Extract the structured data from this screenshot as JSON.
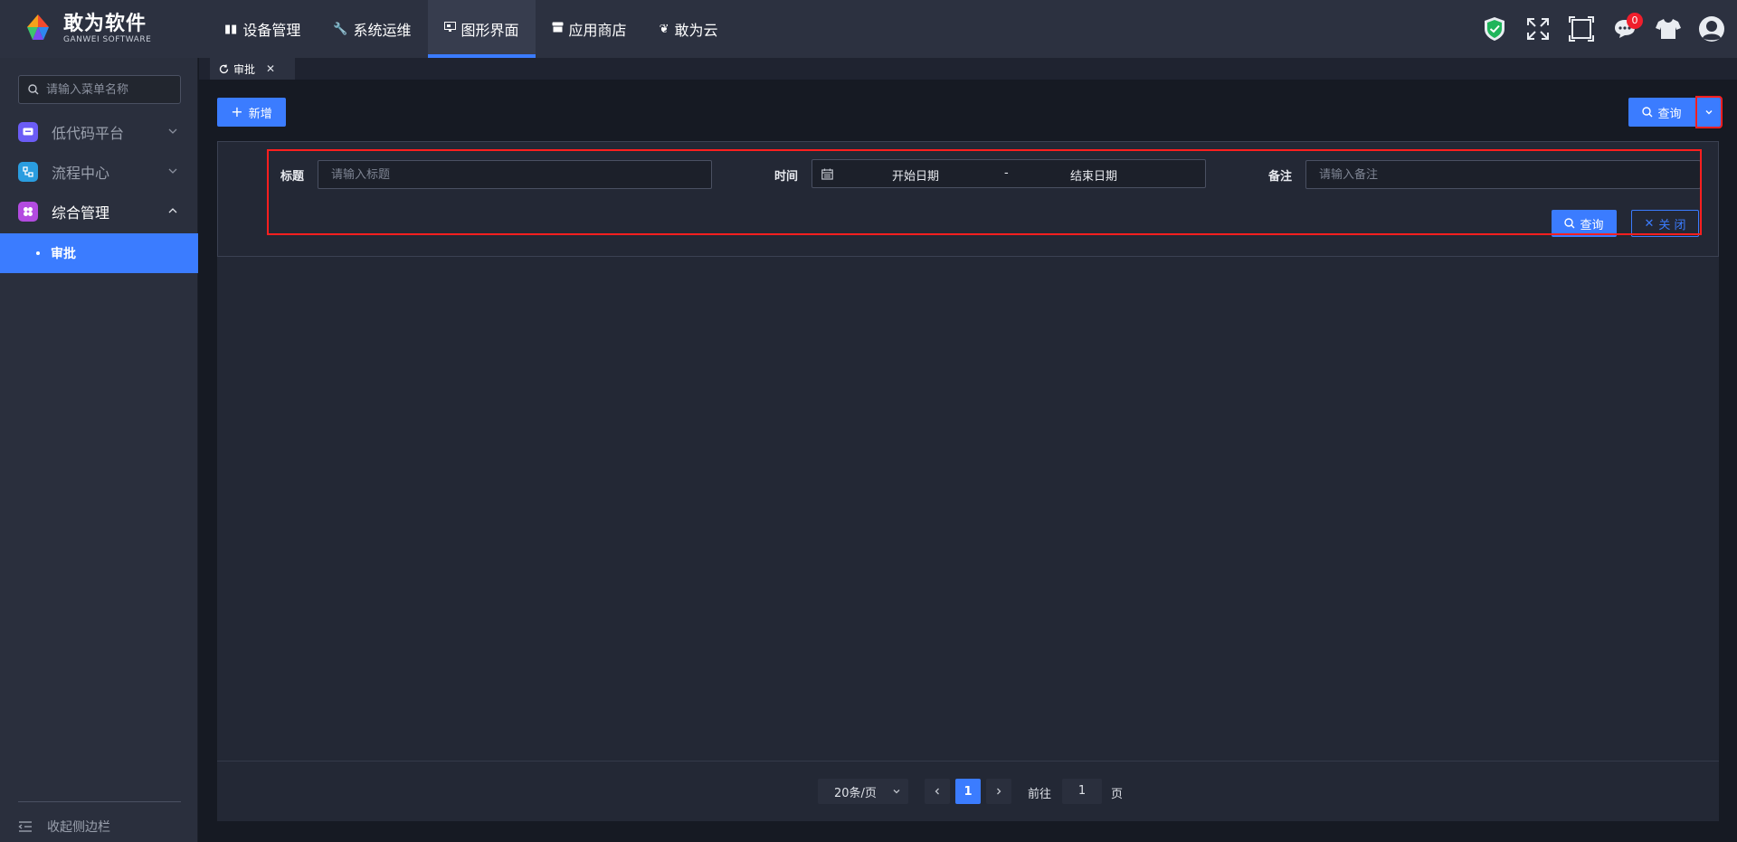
{
  "brand": {
    "title": "敢为软件",
    "subtitle": "GANWEI  SOFTWARE"
  },
  "topnav": [
    {
      "label": "设备管理",
      "icon": "book-icon",
      "active": false
    },
    {
      "label": "系统运维",
      "icon": "wrench-icon",
      "active": false
    },
    {
      "label": "图形界面",
      "icon": "monitor-icon",
      "active": true
    },
    {
      "label": "应用商店",
      "icon": "store-icon",
      "active": false
    },
    {
      "label": "敢为云",
      "icon": "leaf-icon",
      "active": false
    }
  ],
  "header_icons": {
    "security": "shield-check-icon",
    "fullscreen": "expand-icon",
    "screen": "frame-icon",
    "messages": "chat-icon",
    "message_count": "0",
    "theme": "tshirt-icon",
    "user": "avatar-icon"
  },
  "sidebar": {
    "search_placeholder": "请输入菜单名称",
    "items": [
      {
        "label": "低代码平台",
        "expanded": false,
        "icon_color": "#6b5cf6"
      },
      {
        "label": "流程中心",
        "expanded": false,
        "icon_color": "#2a9de0"
      },
      {
        "label": "综合管理",
        "expanded": true,
        "icon_color": "#b34be0"
      }
    ],
    "active_sub": "审批",
    "collapse_label": "收起侧边栏"
  },
  "tabs": [
    {
      "label": "审批"
    }
  ],
  "toolbar": {
    "add_label": "新增",
    "query_label": "查询"
  },
  "filters": {
    "title_label": "标题",
    "title_placeholder": "请输入标题",
    "time_label": "时间",
    "start_date": "开始日期",
    "date_sep": "-",
    "end_date": "结束日期",
    "note_label": "备注",
    "note_placeholder": "请输入备注",
    "query_label": "查询",
    "close_label": "关 闭"
  },
  "pagination": {
    "page_size": "20条/页",
    "current_page": "1",
    "goto_label": "前往",
    "goto_value": "1",
    "page_unit": "页"
  },
  "colors": {
    "accent": "#3b7cff",
    "highlight": "#ff1f1f",
    "badge": "#f01e2c"
  }
}
